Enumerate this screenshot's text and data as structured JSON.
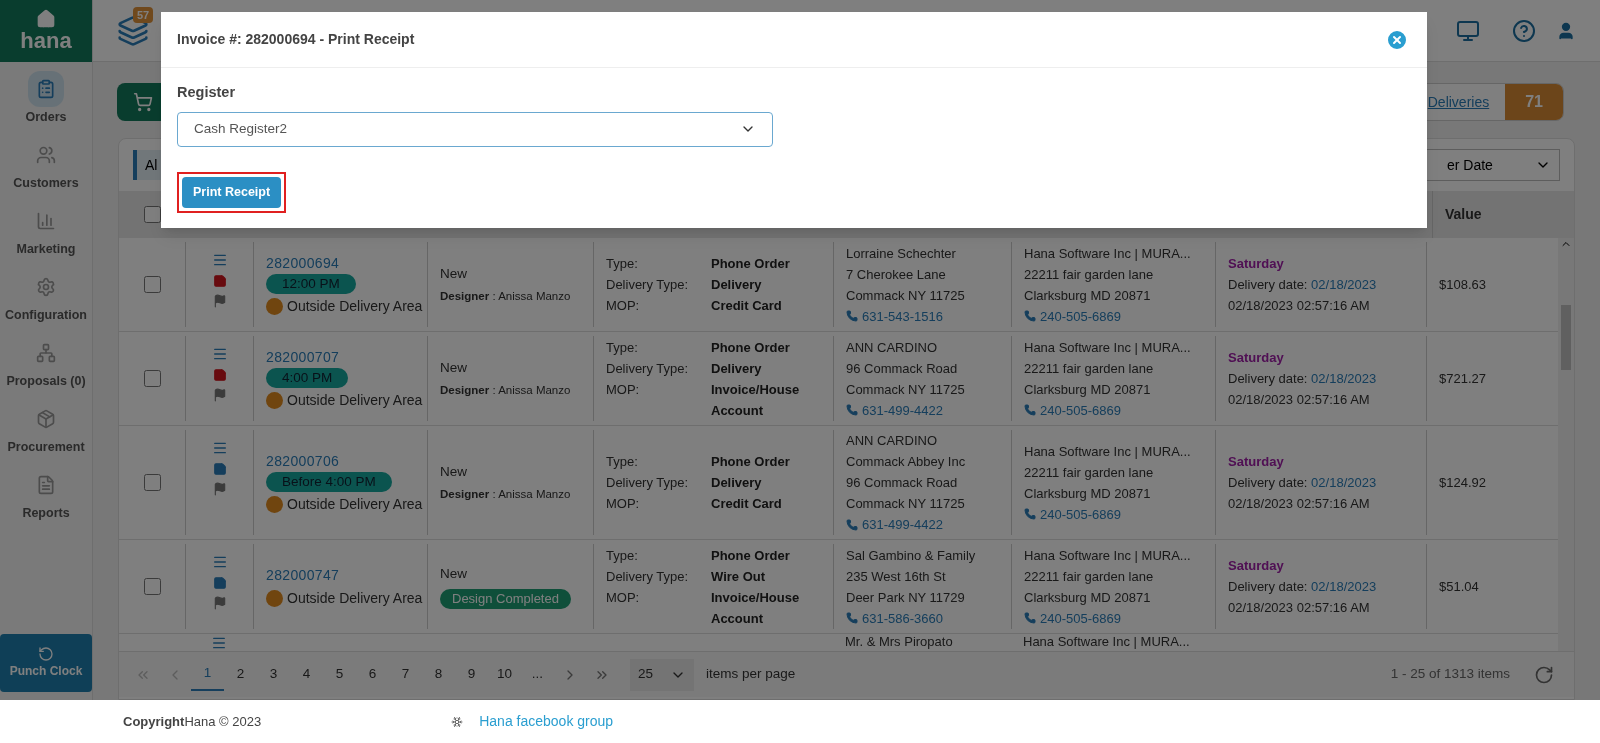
{
  "sidebar": {
    "logo": "hana",
    "items": [
      {
        "label": "Orders",
        "selected": true
      },
      {
        "label": "Customers",
        "selected": false
      },
      {
        "label": "Marketing",
        "selected": false
      },
      {
        "label": "Configuration",
        "selected": false
      },
      {
        "label": "Proposals (0)",
        "selected": false
      },
      {
        "label": "Procurement",
        "selected": false
      },
      {
        "label": "Reports",
        "selected": false
      }
    ],
    "punch_clock": "Punch Clock"
  },
  "topbar": {
    "queue_badge": "57"
  },
  "toolbar": {
    "filter_tab": "Al",
    "deliveries_link": "Deliveries",
    "deliveries_count": "71",
    "sort_select": "er Date"
  },
  "table": {
    "columns": [
      "Value"
    ],
    "select_all_checked": false,
    "rows": [
      {
        "checked": false,
        "color": "#680b0f",
        "order": "282000694",
        "time": "12:00 PM",
        "zone": "Outside Delivery Area",
        "status": "New",
        "designer": "**Designer** : Anissa Manzo",
        "details": [
          {
            "label": "Type:",
            "value": "Phone Order"
          },
          {
            "label": "Delivery Type:",
            "value": "Delivery"
          },
          {
            "label": "MOP:",
            "value": "Credit Card"
          }
        ],
        "customer": [
          "Lorraine Schechter",
          "7 Cherokee Lane",
          "Commack NY 11725"
        ],
        "customer_phone": "631-543-1516",
        "recipient": [
          "Hana Software Inc | MURA...",
          "22211 fair garden lane",
          "Clarksburg MD 20871"
        ],
        "recipient_phone": "240-505-6869",
        "day": "Saturday",
        "delivery_label": "Delivery date:",
        "delivery_date": "02/18/2023",
        "created": "02/18/2023 02:57:16 AM",
        "value": "$108.63"
      },
      {
        "checked": false,
        "color": "#680b0f",
        "order": "282000707",
        "time": "4:00 PM",
        "zone": "Outside Delivery Area",
        "status": "New",
        "designer": "**Designer** : Anissa Manzo",
        "details": [
          {
            "label": "Type:",
            "value": "Phone Order"
          },
          {
            "label": "Delivery Type:",
            "value": "Delivery"
          },
          {
            "label": "MOP:",
            "value": "Invoice/House Account"
          }
        ],
        "customer": [
          "ANN CARDINO",
          "96 Commack Road",
          "Commack NY 11725"
        ],
        "customer_phone": "631-499-4422",
        "recipient": [
          "Hana Software Inc | MURA...",
          "22211 fair garden lane",
          "Clarksburg MD 20871"
        ],
        "recipient_phone": "240-505-6869",
        "day": "Saturday",
        "delivery_label": "Delivery date:",
        "delivery_date": "02/18/2023",
        "created": "02/18/2023 02:57:16 AM",
        "value": "$721.27"
      },
      {
        "checked": false,
        "color": "#153e5c",
        "order": "282000706",
        "time": "Before 4:00 PM",
        "zone": "Outside Delivery Area",
        "status": "New",
        "designer": "**Designer** : Anissa Manzo",
        "details": [
          {
            "label": "Type:",
            "value": "Phone Order"
          },
          {
            "label": "Delivery Type:",
            "value": "Delivery"
          },
          {
            "label": "MOP:",
            "value": "Credit Card"
          }
        ],
        "customer": [
          "ANN CARDINO",
          "Commack Abbey Inc",
          "96 Commack Road",
          "Commack NY 11725"
        ],
        "customer_phone": "631-499-4422",
        "recipient": [
          "Hana Software Inc | MURA...",
          "22211 fair garden lane",
          "Clarksburg MD 20871"
        ],
        "recipient_phone": "240-505-6869",
        "day": "Saturday",
        "delivery_label": "Delivery date:",
        "delivery_date": "02/18/2023",
        "created": "02/18/2023 02:57:16 AM",
        "value": "$124.92"
      },
      {
        "checked": false,
        "color": "#153e5c",
        "order": "282000747",
        "zone": "Outside Delivery Area",
        "status": "New",
        "badge": "Design Completed",
        "details": [
          {
            "label": "Type:",
            "value": "Phone Order"
          },
          {
            "label": "Delivery Type:",
            "value": "Wire Out"
          },
          {
            "label": "MOP:",
            "value": "Invoice/House Account"
          }
        ],
        "customer": [
          "Sal Gambino & Family",
          "235 West 16th St",
          "Deer Park NY 11729"
        ],
        "customer_phone": "631-586-3660",
        "recipient": [
          "Hana Software Inc | MURA...",
          "22211 fair garden lane",
          "Clarksburg MD 20871"
        ],
        "recipient_phone": "240-505-6869",
        "day": "Saturday",
        "delivery_label": "Delivery date:",
        "delivery_date": "02/18/2023",
        "created": "02/18/2023 02:57:16 AM",
        "value": "$51.04"
      }
    ],
    "partial_row": {
      "customer": "Mr. & Mrs Piropato",
      "recipient": "Hana Software Inc | MURA..."
    }
  },
  "pagination": {
    "pages": [
      {
        "label": "1",
        "selected": true
      },
      {
        "label": "2",
        "selected": false
      },
      {
        "label": "3",
        "selected": false
      },
      {
        "label": "4",
        "selected": false
      },
      {
        "label": "5",
        "selected": false
      },
      {
        "label": "6",
        "selected": false
      },
      {
        "label": "7",
        "selected": false
      },
      {
        "label": "8",
        "selected": false
      },
      {
        "label": "9",
        "selected": false
      },
      {
        "label": "10",
        "selected": false
      },
      {
        "label": "...",
        "selected": false
      }
    ],
    "page_size": "25",
    "page_size_label": "items per page",
    "summary": "1 - 25 of 1313 items"
  },
  "footer": {
    "copyright_label": "Copyright",
    "copyright": "Hana © 2023",
    "link": "Hana facebook group"
  },
  "modal": {
    "title": "Invoice #: 282000694 - Print Receipt",
    "field_label": "Register",
    "register": "Cash Register2",
    "button": "Print Receipt"
  }
}
